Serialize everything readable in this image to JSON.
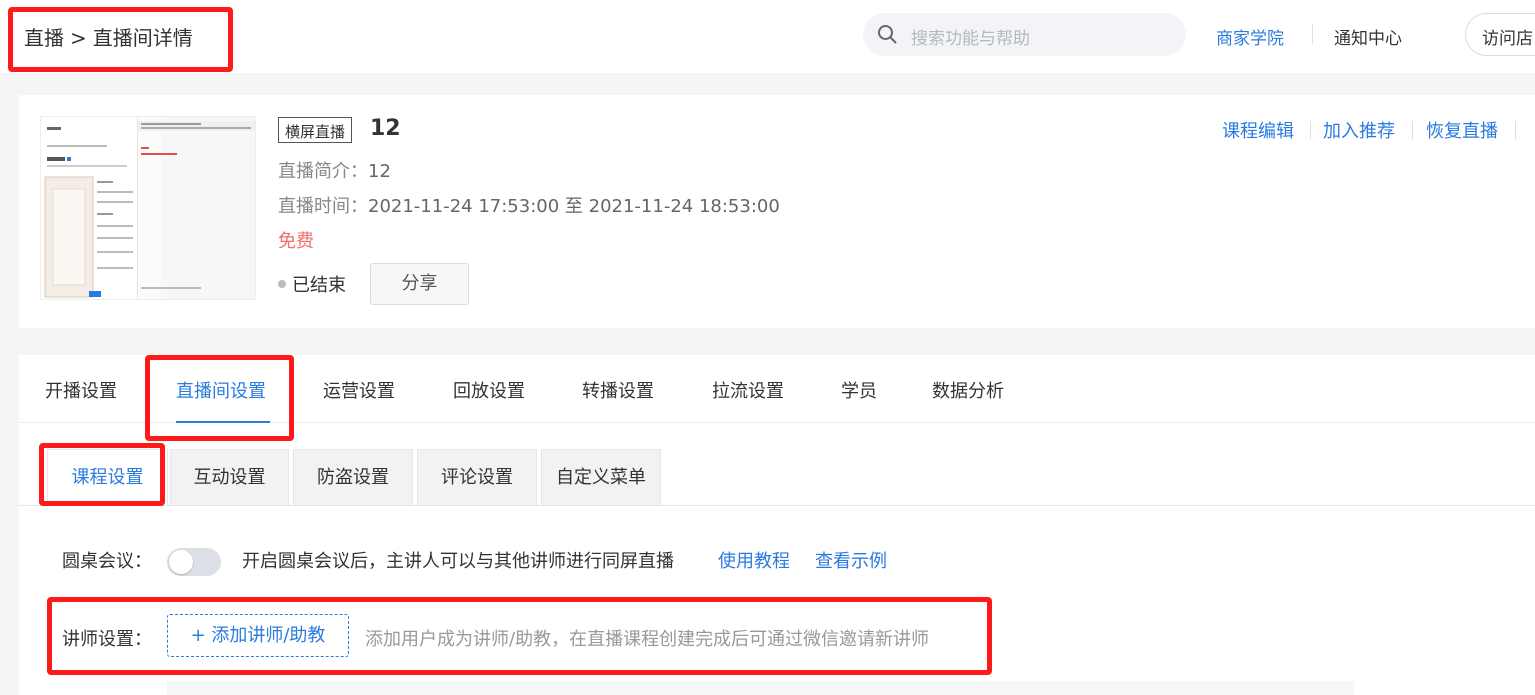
{
  "header": {
    "breadcrumb": [
      "直播",
      "直播间详情"
    ],
    "breadcrumb_sep": ">",
    "search_placeholder": "搜索功能与帮助",
    "links": [
      "商家学院",
      "通知中心"
    ],
    "visit_button": "访问店"
  },
  "course": {
    "type_badge": "横屏直播",
    "title": "12",
    "intro_label": "直播简介：",
    "intro_value": "12",
    "time_label": "直播时间：",
    "time_value": "2021-11-24 17:53:00 至 2021-11-24 18:53:00",
    "price": "免费",
    "status": "已结束",
    "share_button": "分享",
    "actions": [
      "课程编辑",
      "加入推荐",
      "恢复直播"
    ]
  },
  "main_tabs": [
    "开播设置",
    "直播间设置",
    "运营设置",
    "回放设置",
    "转播设置",
    "拉流设置",
    "学员",
    "数据分析"
  ],
  "active_main_tab": "直播间设置",
  "sub_tabs": [
    "课程设置",
    "互动设置",
    "防盗设置",
    "评论设置",
    "自定义菜单"
  ],
  "active_sub_tab": "课程设置",
  "roundtable": {
    "label": "圆桌会议：",
    "enabled": false,
    "description": "开启圆桌会议后，主讲人可以与其他讲师进行同屏直播",
    "links": [
      "使用教程",
      "查看示例"
    ]
  },
  "lecturer": {
    "label": "讲师设置：",
    "add_button": "+ 添加讲师/助教",
    "hint": "添加用户成为讲师/助教，在直播课程创建完成后可通过微信邀请新讲师"
  },
  "colors": {
    "accent": "#2a7be0",
    "price": "#f56c6c",
    "highlight": "#ff1a1a"
  }
}
